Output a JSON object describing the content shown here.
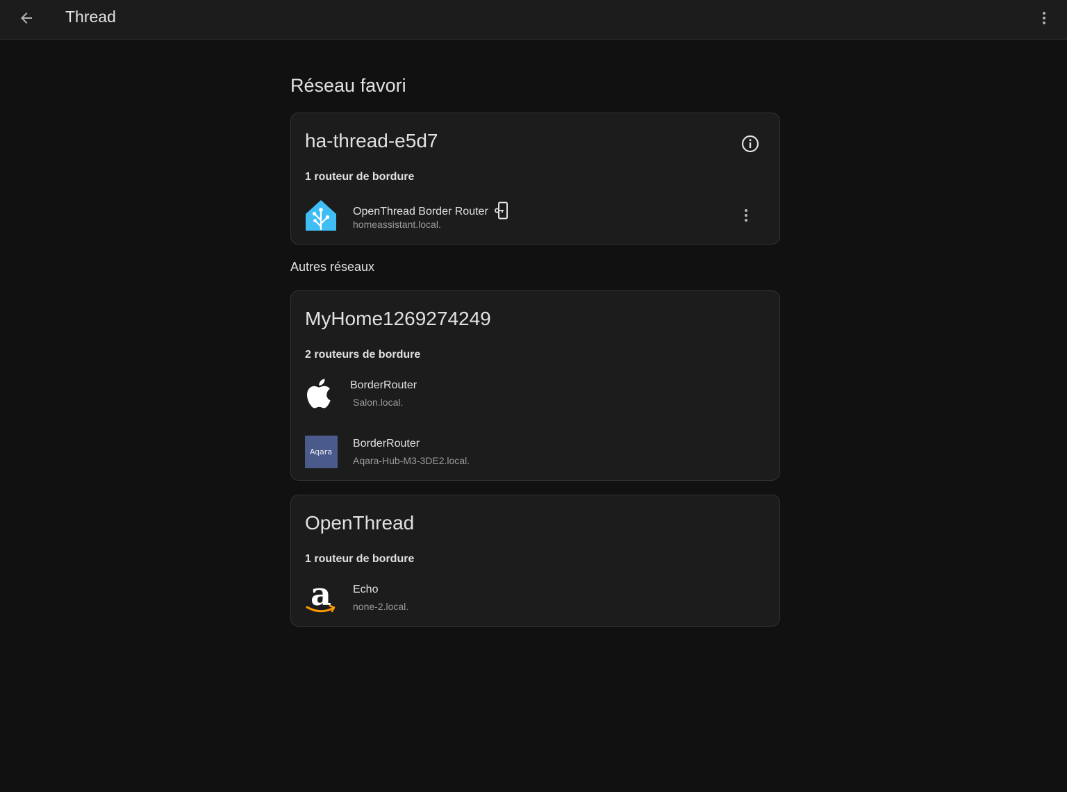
{
  "header": {
    "title": "Thread"
  },
  "preferred": {
    "section_title": "Réseau favori",
    "network": {
      "name": "ha-thread-e5d7",
      "router_count": "1 routeur de bordure",
      "routers": [
        {
          "name": "OpenThread Border Router",
          "host": "homeassistant.local.",
          "logo": "home-assistant-icon"
        }
      ]
    }
  },
  "others": {
    "section_title": "Autres réseaux",
    "networks": [
      {
        "name": "MyHome1269274249",
        "router_count": "2 routeurs de bordure",
        "routers": [
          {
            "name": "BorderRouter",
            "host": "Salon.local.",
            "logo": "apple-icon"
          },
          {
            "name": "BorderRouter",
            "host": "Aqara-Hub-M3-3DE2.local.",
            "logo": "aqara-icon",
            "logo_text": "Aqara"
          }
        ]
      },
      {
        "name": "OpenThread",
        "router_count": "1 routeur de bordure",
        "routers": [
          {
            "name": "Echo",
            "host": "none-2.local.",
            "logo": "amazon-icon"
          }
        ]
      }
    ]
  },
  "colors": {
    "background": "#111111",
    "card": "#1c1c1c",
    "home_assistant_blue": "#41bdf5",
    "aqara_blue": "#4a5a8a",
    "amazon_orange": "#ff9900"
  }
}
